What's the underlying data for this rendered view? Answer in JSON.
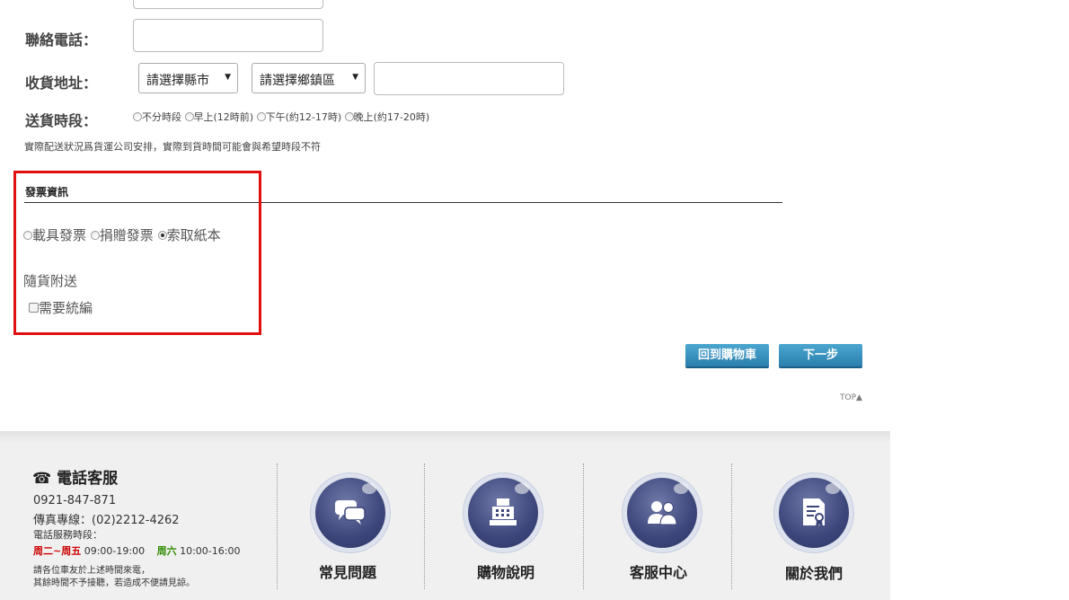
{
  "form": {
    "phone_label": "聯絡電話：",
    "address_label": "收貨地址：",
    "county_select": "請選擇縣市",
    "district_select": "請選擇鄉鎮區",
    "delivery_label": "送貨時段：",
    "delivery_options": [
      "不分時段",
      "早上(12時前)",
      "下午(約12-17時)",
      "晚上(約17-20時)"
    ],
    "delivery_note": "實際配送狀況爲貨運公司安排，實際到貨時間可能會與希望時段不符"
  },
  "invoice": {
    "title": "發票資訊",
    "options": [
      "載具發票",
      "捐贈發票",
      "索取紙本"
    ],
    "selected_index": 2,
    "ship_text": "隨貨附送",
    "tax_id_label": "需要統編"
  },
  "actions": {
    "back_label": "回到購物車",
    "next_label": "下一步",
    "top_label": "TOP▲"
  },
  "footer": {
    "title": "☎ 電話客服",
    "phone": "0921-847-871",
    "fax": "傳真專線：(02)2212-4262",
    "hours_label": "電話服務時段：",
    "weekday_days": "周二~周五",
    "weekday_hours": "09:00-19:00",
    "saturday_day": "周六",
    "saturday_hours": "10:00-16:00",
    "notice_1": "請各位車友於上述時間來電，",
    "notice_2": "其餘時間不予接聽，若造成不便請見諒。",
    "links": [
      "常見問題",
      "購物說明",
      "客服中心",
      "關於我們"
    ],
    "colors": {
      "weekday": "#cc0000",
      "saturday": "#2e8b00"
    }
  },
  "colors": {
    "highlight": "#e01010",
    "button": "#2f88b8"
  }
}
